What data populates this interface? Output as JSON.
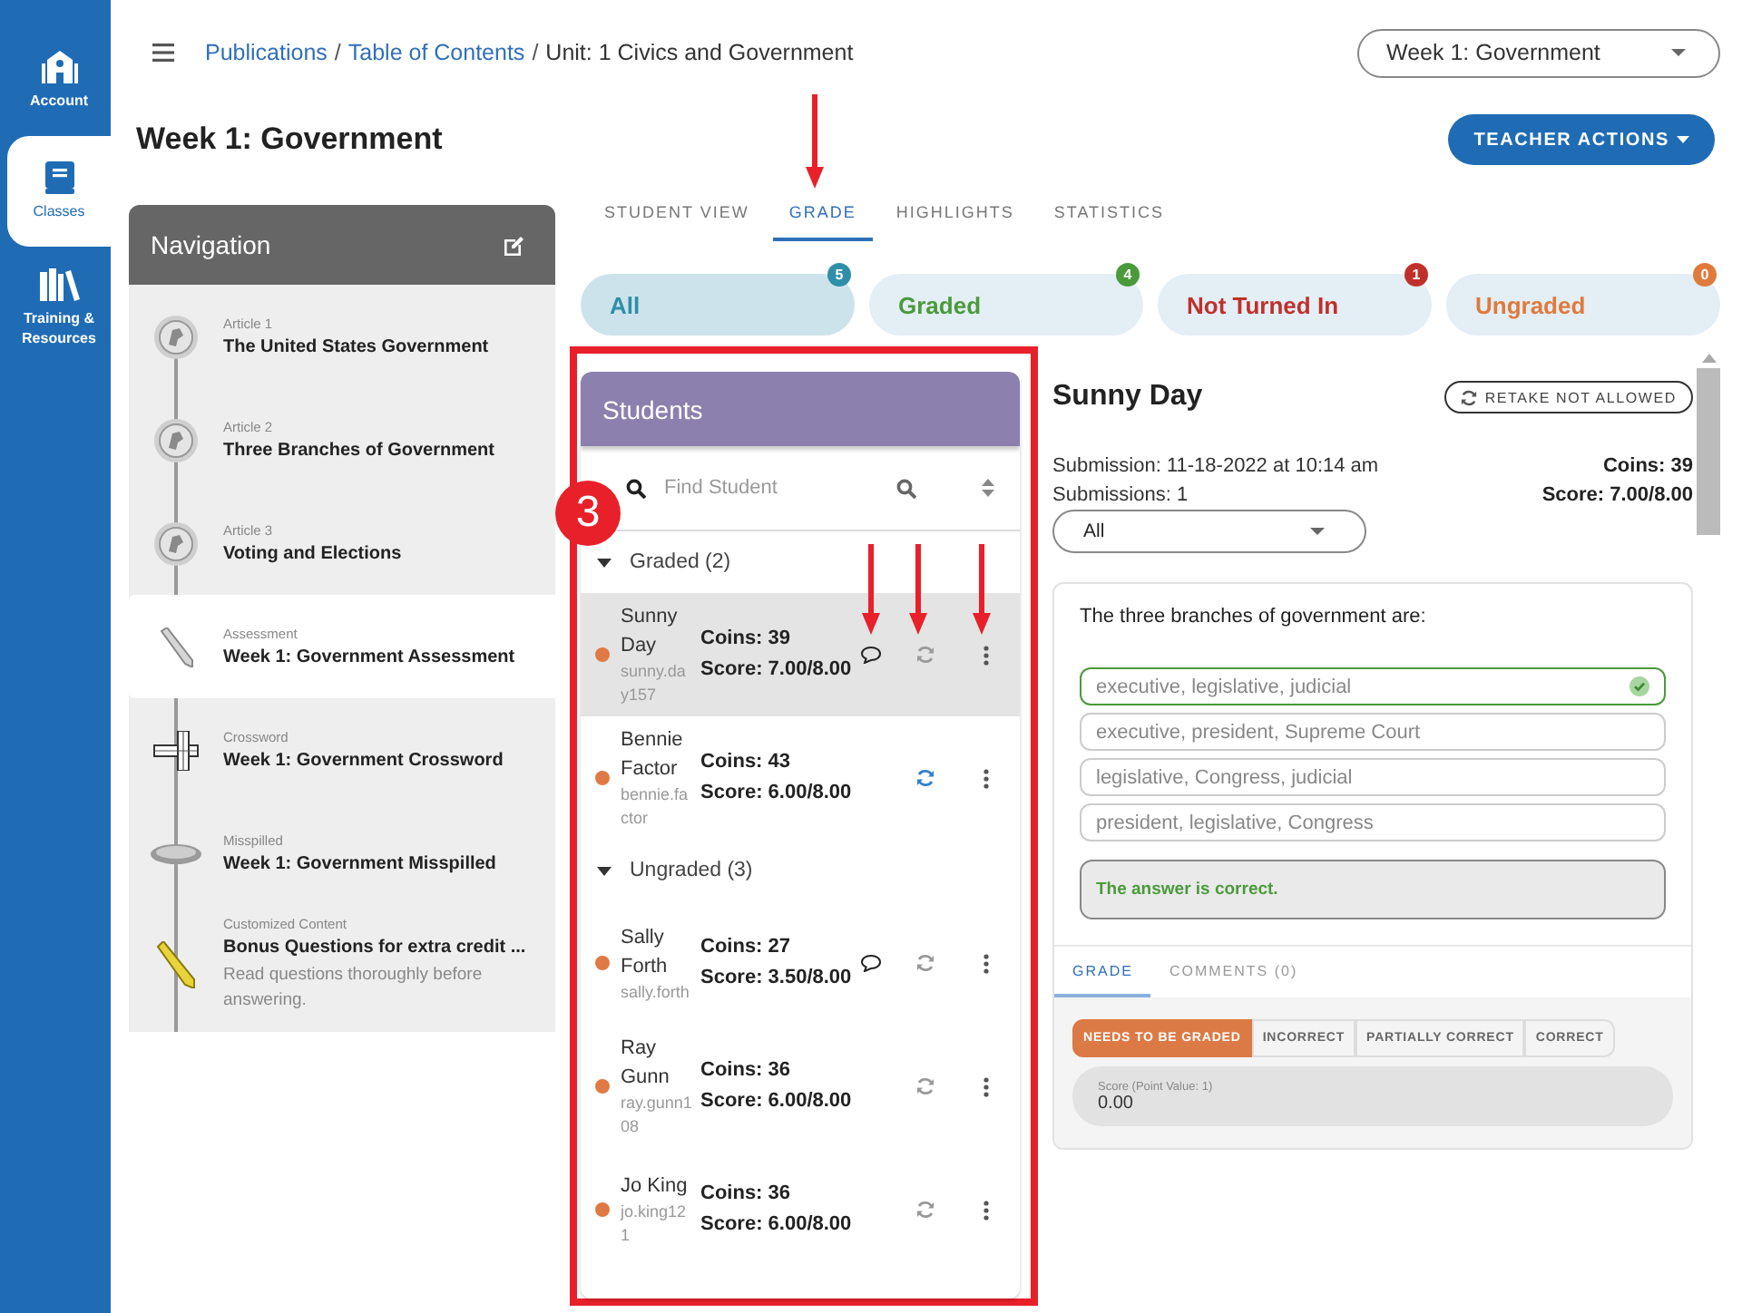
{
  "rail": {
    "items": [
      {
        "label": "Account",
        "kind": "account",
        "selected": false
      },
      {
        "label": "Classes",
        "kind": "classes",
        "selected": true
      },
      {
        "label": "Training & Resources",
        "kind": "training",
        "selected": false
      }
    ]
  },
  "breadcrumb": {
    "links": [
      "Publications",
      "Table of Contents"
    ],
    "separator": "/",
    "current": "Unit: 1 Civics and Government"
  },
  "week_select": "Week 1: Government",
  "page_title": "Week 1: Government",
  "teacher_actions": "TEACHER ACTIONS",
  "navigation": {
    "title": "Navigation",
    "items": [
      {
        "kind": "medallion",
        "type": "Article 1",
        "title": "The United States Government",
        "selected": false
      },
      {
        "kind": "medallion",
        "type": "Article 2",
        "title": "Three Branches of Government",
        "selected": false
      },
      {
        "kind": "medallion",
        "type": "Article 3",
        "title": "Voting and Elections",
        "selected": false
      },
      {
        "kind": "pencil",
        "type": "Assessment",
        "title": "Week 1: Government Assessment",
        "selected": true
      },
      {
        "kind": "crossword",
        "type": "Crossword",
        "title": "Week 1: Government Crossword",
        "selected": false
      },
      {
        "kind": "tablet",
        "type": "Misspilled",
        "title": "Week 1: Government Misspilled",
        "selected": false
      },
      {
        "kind": "yellow-pencil",
        "type": "Customized Content",
        "title": "Bonus Questions for extra credit ...",
        "description": "Read questions thoroughly before answering.",
        "selected": false
      }
    ]
  },
  "tabs": [
    {
      "label": "STUDENT VIEW",
      "selected": false
    },
    {
      "label": "GRADE",
      "selected": true
    },
    {
      "label": "HIGHLIGHTS",
      "selected": false
    },
    {
      "label": "STATISTICS",
      "selected": false
    }
  ],
  "filters": [
    {
      "label": "All",
      "count": "5",
      "color": "#2f8fa8",
      "selected": true
    },
    {
      "label": "Graded",
      "count": "4",
      "color": "#4a9a3a",
      "selected": false
    },
    {
      "label": "Not Turned In",
      "count": "1",
      "color": "#c0302a",
      "selected": false
    },
    {
      "label": "Ungraded",
      "count": "0",
      "color": "#e07a3c",
      "selected": false
    }
  ],
  "students": {
    "title": "Students",
    "search_placeholder": "Find Student",
    "groups": [
      {
        "label": "Graded (2)",
        "expanded": true,
        "students": [
          {
            "name": "Sunny Day",
            "username": "sunny.day157",
            "coins": "Coins: 39",
            "score": "Score: 7.00/8.00",
            "color": "#e07a45",
            "selected": true,
            "comment": true,
            "retake_active": false
          },
          {
            "name": "Bennie Factor",
            "username": "bennie.factor",
            "coins": "Coins: 43",
            "score": "Score: 6.00/8.00",
            "color": "#e07a45",
            "selected": false,
            "comment": false,
            "retake_active": true
          }
        ]
      },
      {
        "label": "Ungraded (3)",
        "expanded": true,
        "students": [
          {
            "name": "Sally Forth",
            "username": "sally.forth",
            "coins": "Coins: 27",
            "score": "Score: 3.50/8.00",
            "color": "#e07a45",
            "selected": false,
            "comment": true,
            "retake_active": false
          },
          {
            "name": "Ray Gunn",
            "username": "ray.gunn108",
            "coins": "Coins: 36",
            "score": "Score: 6.00/8.00",
            "color": "#e07a45",
            "selected": false,
            "comment": false,
            "retake_active": false
          },
          {
            "name": "Jo King",
            "username": "jo.king121",
            "coins": "Coins: 36",
            "score": "Score: 6.00/8.00",
            "color": "#e07a45",
            "selected": false,
            "comment": false,
            "retake_active": false
          }
        ]
      }
    ]
  },
  "detail": {
    "name": "Sunny Day",
    "retake": "RETAKE NOT ALLOWED",
    "submission": "Submission: 11-18-2022 at 10:14 am",
    "submissions": "Submissions: 1",
    "coins": "Coins: 39",
    "score": "Score: 7.00/8.00",
    "attempt_select": "All",
    "question": "The three branches of government are:",
    "options": [
      {
        "text": "executive, legislative, judicial",
        "selected": true
      },
      {
        "text": "executive, president, Supreme Court",
        "selected": false
      },
      {
        "text": "legislative, Congress, judicial",
        "selected": false
      },
      {
        "text": "president, legislative, Congress",
        "selected": false
      }
    ],
    "feedback": "The answer is correct.",
    "tabs": [
      {
        "label": "GRADE",
        "selected": true
      },
      {
        "label": "COMMENTS (0)",
        "selected": false
      }
    ],
    "grades": [
      {
        "label": "NEEDS TO BE GRADED",
        "selected": true
      },
      {
        "label": "INCORRECT",
        "selected": false
      },
      {
        "label": "PARTIALLY CORRECT",
        "selected": false
      },
      {
        "label": "CORRECT",
        "selected": false
      }
    ],
    "score_field": {
      "label": "Score (Point Value: 1)",
      "value": "0.00"
    }
  },
  "annotations": {
    "step": "3"
  }
}
